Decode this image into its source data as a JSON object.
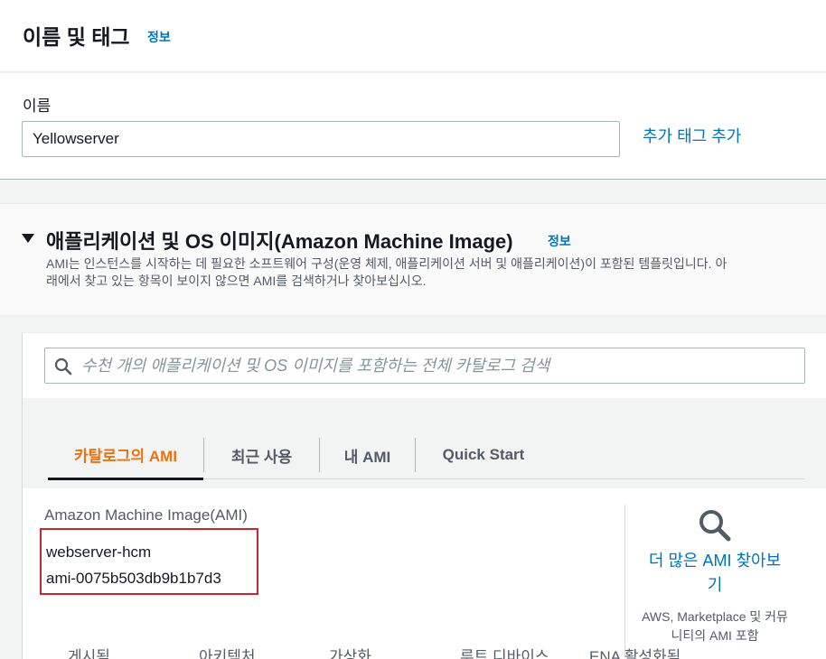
{
  "name_section": {
    "title": "이름 및 태그",
    "info_link": "정보",
    "name_label": "이름",
    "name_value": "Yellowserver",
    "add_tag_link": "추가 태그 추가"
  },
  "ami_section": {
    "title": "애플리케이션 및 OS 이미지(Amazon Machine Image)",
    "info_link": "정보",
    "description_line1": "AMI는 인스턴스를 시작하는 데 필요한 소프트웨어 구성(운영 체제, 애플리케이션 서버 및 애플리케이션)이 포함된 템플릿입니다. 아",
    "description_line2": "래에서 찾고 있는 항목이 보이지 않으면 AMI를 검색하거나 찾아보십시오.",
    "search": {
      "placeholder": "수천 개의 애플리케이션 및 OS 이미지를 포함하는 전체 카탈로그 검색",
      "icon": "search-icon"
    },
    "tabs": [
      {
        "label": "카탈로그의 AMI",
        "active": true
      },
      {
        "label": "최근 사용",
        "active": false
      },
      {
        "label": "내 AMI",
        "active": false
      },
      {
        "label": "Quick Start",
        "active": false
      }
    ],
    "ami_label": "Amazon Machine Image(AMI)",
    "selected_ami": {
      "name": "webserver-hcm",
      "id": "ami-0075b503db9b1b7d3"
    },
    "browse_more": {
      "link": "더 많은 AMI 찾아보기",
      "subtext": "AWS, Marketplace 및 커뮤니티의 AMI 포함"
    },
    "table_headers": [
      "게시됨",
      "아키텍처",
      "가상화",
      "루트 디바이스",
      "ENA 활성화됨"
    ]
  },
  "colors": {
    "link": "#0073bb",
    "active_tab": "#ec7211",
    "highlight_border": "#c7272e"
  }
}
